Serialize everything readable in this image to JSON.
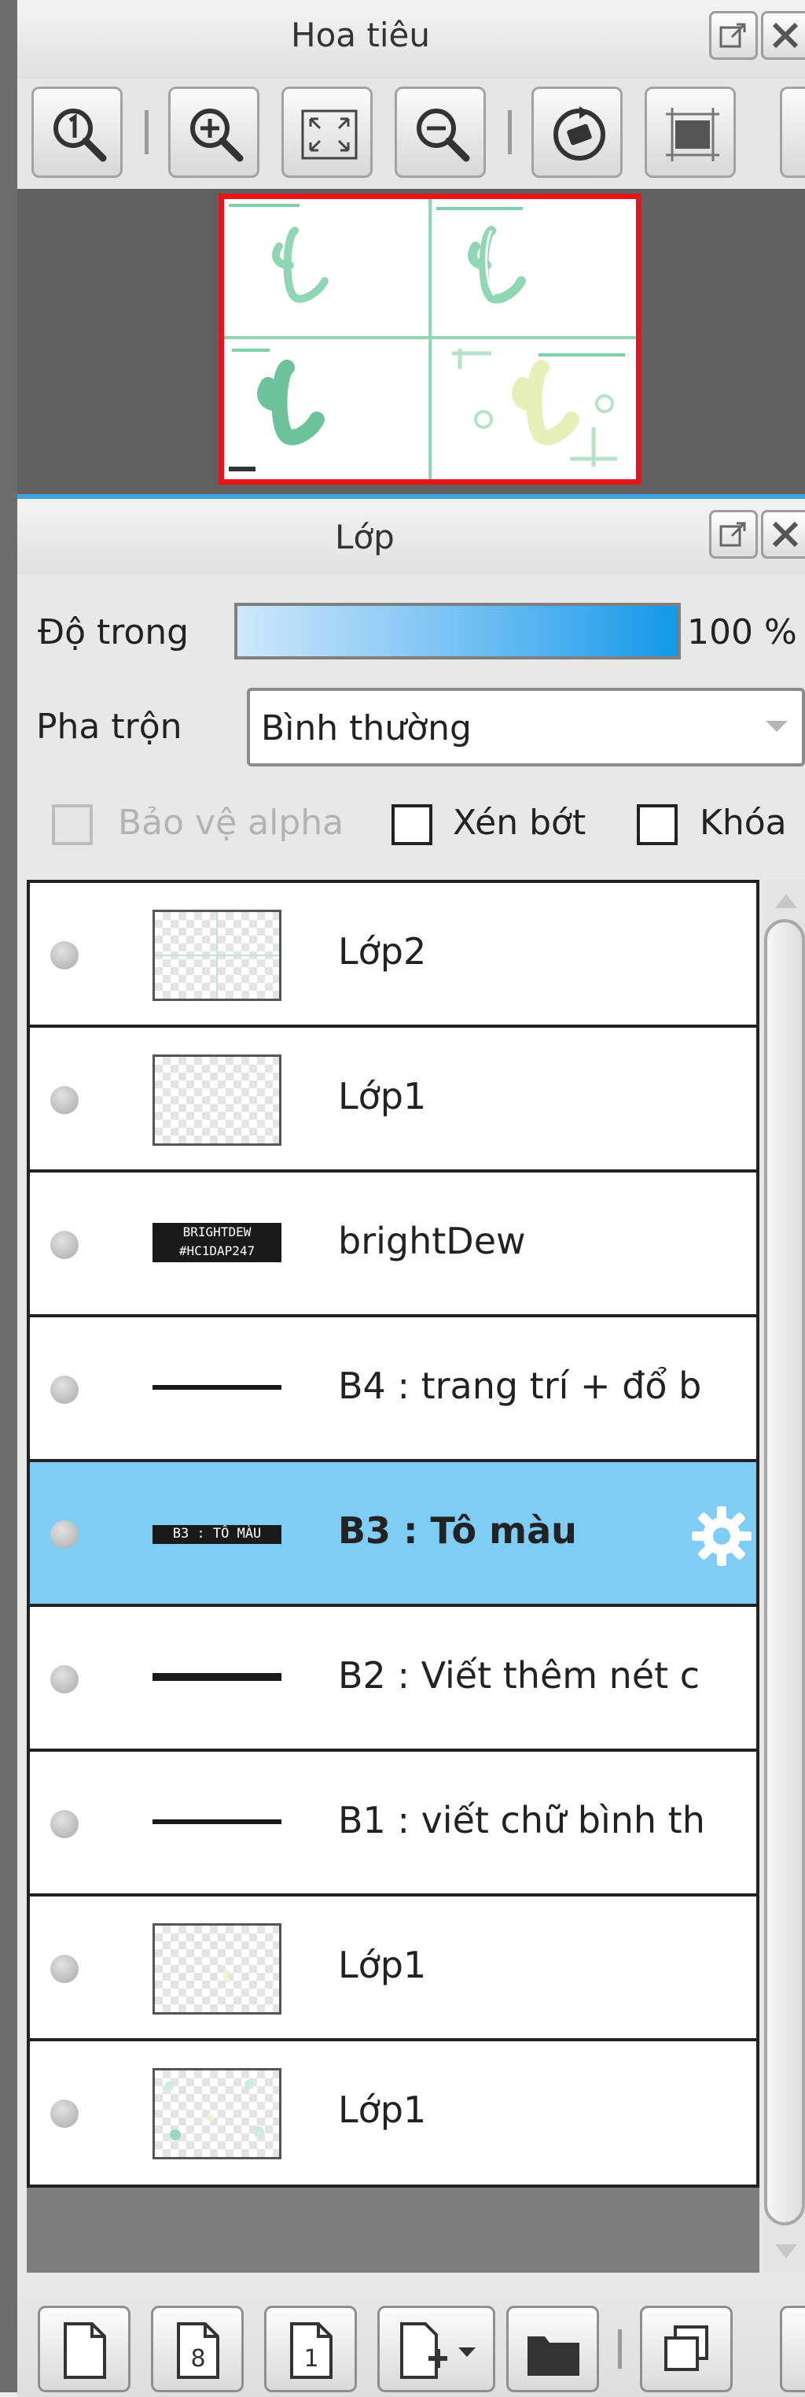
{
  "navigator": {
    "title": "Hoa tiêu",
    "toolbar": {
      "icons": [
        "zoom-actual-icon",
        "zoom-in-icon",
        "fit-window-icon",
        "zoom-out-icon",
        "rotate-reset-icon",
        "fit-canvas-icon"
      ]
    }
  },
  "layer_panel": {
    "title": "Lớp",
    "opacity": {
      "label": "Độ trong",
      "value_text": "100 %",
      "value": 1.0
    },
    "blend": {
      "label": "Pha trộn",
      "value": "Bình thường"
    },
    "checkboxes": {
      "protect_alpha": "Bảo vệ alpha",
      "clip": "Xén bớt",
      "lock": "Khóa"
    },
    "layers": [
      {
        "name": "Lớp2",
        "thumb": "checker",
        "selected": false
      },
      {
        "name": "Lớp1",
        "thumb": "checker",
        "selected": false
      },
      {
        "name": "brightDew",
        "thumb": "text",
        "thumb_text": "BRIGHTDEW #HC1DAP247",
        "selected": false
      },
      {
        "name": "B4 : trang trí + đổ b",
        "thumb": "line",
        "selected": false
      },
      {
        "name": "B3 : Tô màu",
        "thumb": "text",
        "thumb_text": "B3 : TÔ MÀU",
        "selected": true
      },
      {
        "name": "B2 : Viết thêm nét c",
        "thumb": "line",
        "selected": false
      },
      {
        "name": "B1 : viết chữ bình th",
        "thumb": "line",
        "selected": false
      },
      {
        "name": "Lớp1",
        "thumb": "checker",
        "selected": false
      },
      {
        "name": "Lớp1",
        "thumb": "checker",
        "selected": false
      }
    ],
    "bottom_toolbar": {
      "icons": [
        "new-layer-icon",
        "new-8bit-layer-icon",
        "new-1bit-layer-icon",
        "add-layer-menu-icon",
        "new-folder-icon",
        "duplicate-layer-icon"
      ],
      "labels": [
        "8",
        "1"
      ]
    }
  },
  "colors": {
    "accent": "#3da4e2",
    "selection": "#7fcdf4",
    "preview_border": "#e8141a",
    "preview_green": "#7fd0a8"
  }
}
